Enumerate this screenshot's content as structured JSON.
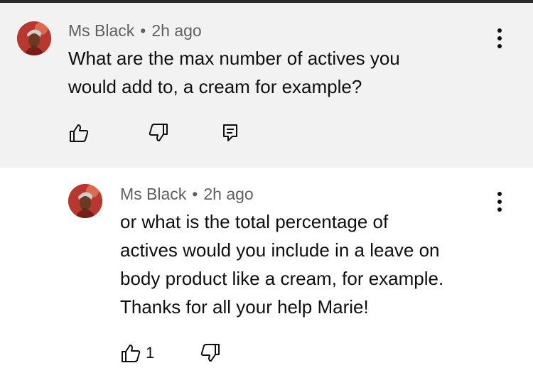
{
  "comments": [
    {
      "author": "Ms Black",
      "separator": "•",
      "time": "2h ago",
      "lines": [
        "What are the max number of actives you",
        "would add to, a cream for example?"
      ]
    },
    {
      "author": "Ms Black",
      "separator": "•",
      "time": "2h ago",
      "lines": [
        "or what is the total percentage of",
        "actives would you include in a leave on",
        "body product like a cream, for example.",
        "Thanks for all your help Marie!"
      ],
      "like_count": "1"
    }
  ],
  "icons": {
    "like": "thumbs-up-icon",
    "dislike": "thumbs-down-icon",
    "reply": "comment-reply-icon",
    "more": "more-vertical-icon"
  },
  "colors": {
    "highlight_bg": "#f2f2f2",
    "meta_text": "#606060",
    "body_text": "#0f0f0f",
    "avatar_bg": "#b8372f"
  }
}
